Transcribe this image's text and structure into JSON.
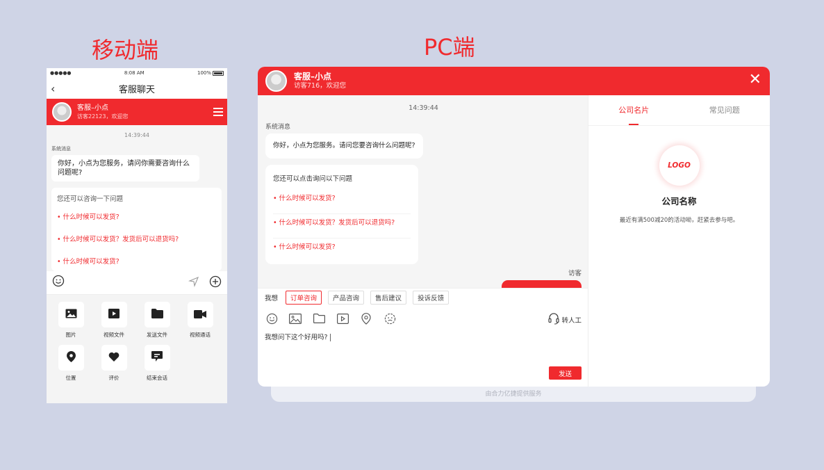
{
  "labels": {
    "mobile": "移动端",
    "pc": "PC端"
  },
  "colors": {
    "brand_red": "#f02a2e",
    "background": "#cfd4e6"
  },
  "mobile": {
    "status": {
      "signal": "●●●●● ",
      "time": "8:08 AM",
      "battery": "100%"
    },
    "nav": {
      "back_icon": "chevron-left-icon",
      "title": "客服聊天"
    },
    "agent": {
      "name": "客服–小点",
      "subtitle": "访客22123，欢迎您"
    },
    "chat": {
      "time": "14:39:44",
      "system_label": "系统消息",
      "greeting": "你好，小点为您服务，请问你需要咨询什么问题呢?",
      "faq_title": "您还可以咨询一下问题",
      "faq": [
        "• 什么时候可以发货?",
        "• 什么时候可以发货？发货后可以退货吗?",
        "• 什么时候可以发货?"
      ]
    },
    "tools": [
      {
        "icon": "image-icon",
        "label": "图片"
      },
      {
        "icon": "video-file-icon",
        "label": "视频文件"
      },
      {
        "icon": "folder-icon",
        "label": "发送文件"
      },
      {
        "icon": "video-call-icon",
        "label": "视频通话"
      },
      {
        "icon": "location-icon",
        "label": "位置"
      },
      {
        "icon": "heart-icon",
        "label": "评价"
      },
      {
        "icon": "end-chat-icon",
        "label": "结束会话"
      }
    ]
  },
  "pc": {
    "agent": {
      "name": "客服–小点",
      "subtitle": "访客716，欢迎您"
    },
    "chat": {
      "time": "14:39:44",
      "system_label": "系统消息",
      "greeting": "你好，小点为您服务。请问您要咨询什么问题呢?",
      "faq_title": "您还可以点击询问以下问题",
      "faq": [
        "• 什么时候可以发货?",
        "• 什么时候可以发货？发货后可以退货吗?",
        "• 什么时候可以发货?"
      ],
      "visitor_label": "访客"
    },
    "tags": {
      "lead": "我想",
      "items": [
        "订单咨询",
        "产品咨询",
        "售后建议",
        "投诉反馈"
      ]
    },
    "toolbar": {
      "human_label": "转人工"
    },
    "input": {
      "value": "我想问下这个好用吗?"
    },
    "send_label": "发送",
    "tabs": [
      "公司名片",
      "常见问题"
    ],
    "card": {
      "logo": "LOGO",
      "company": "公司名称",
      "desc": "最近有满500减20的活动呦，赶紧去参与吧。"
    },
    "footer": "由合力亿捷提供服务"
  }
}
